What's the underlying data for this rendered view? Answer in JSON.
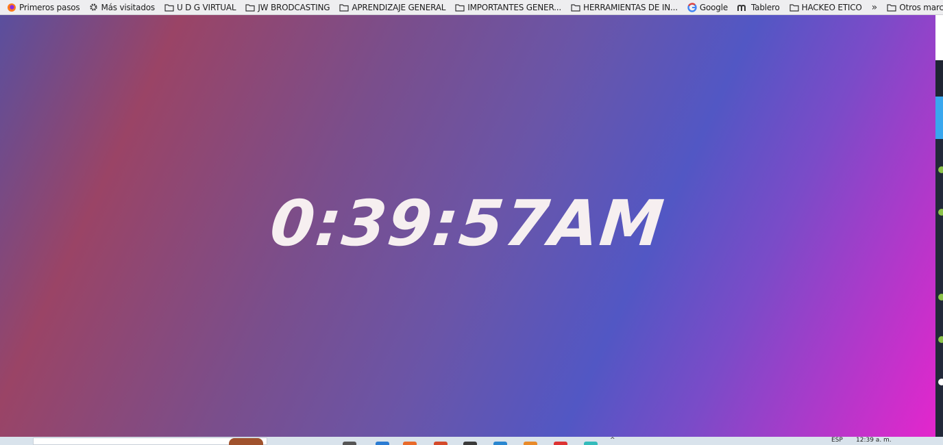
{
  "bookmarks": [
    {
      "label": "Primeros pasos",
      "icon": "firefox-icon"
    },
    {
      "label": "Más visitados",
      "icon": "gear-icon"
    },
    {
      "label": "U D G VIRTUAL",
      "icon": "folder-icon"
    },
    {
      "label": "JW BRODCASTING",
      "icon": "folder-icon"
    },
    {
      "label": "APRENDIZAJE GENERAL",
      "icon": "folder-icon"
    },
    {
      "label": "IMPORTANTES GENER...",
      "icon": "folder-icon"
    },
    {
      "label": "HERRAMIENTAS DE IN...",
      "icon": "folder-icon"
    },
    {
      "label": "Google",
      "icon": "google-icon"
    },
    {
      "label": "Tablero",
      "icon": "moodle-icon"
    },
    {
      "label": "HACKEO ETICO",
      "icon": "folder-icon"
    }
  ],
  "other_bookmarks": "Otros marcadores",
  "clock": {
    "time": "0:39:57AM"
  },
  "taskbar": {
    "language": "ESP",
    "time": "12:39 a. m."
  },
  "colors": {
    "gradient": [
      "#5a4f9e",
      "#9a4466",
      "#7a4e8c",
      "#5257c4",
      "#e426cc"
    ],
    "clock_text": "#f6eff0"
  }
}
